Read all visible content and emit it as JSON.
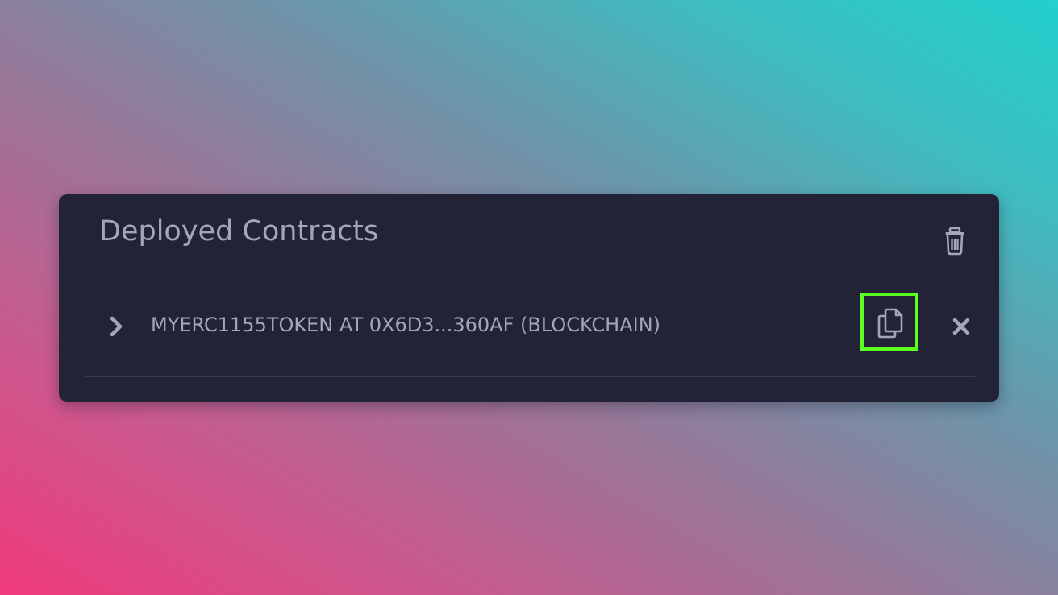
{
  "panel": {
    "title": "Deployed Contracts"
  },
  "contracts": [
    {
      "label": "MYERC1155TOKEN AT 0X6D3...360AF (BLOCKCHAIN)",
      "copy_highlighted": true
    }
  ],
  "icons": {
    "clear": "trash-icon",
    "expand": "chevron-right-icon",
    "copy": "copy-icon",
    "remove": "close-icon"
  },
  "colors": {
    "panel_bg": "#222336",
    "text": "#a2a5bc",
    "highlight": "#5cff1f",
    "divider": "#363a50"
  }
}
